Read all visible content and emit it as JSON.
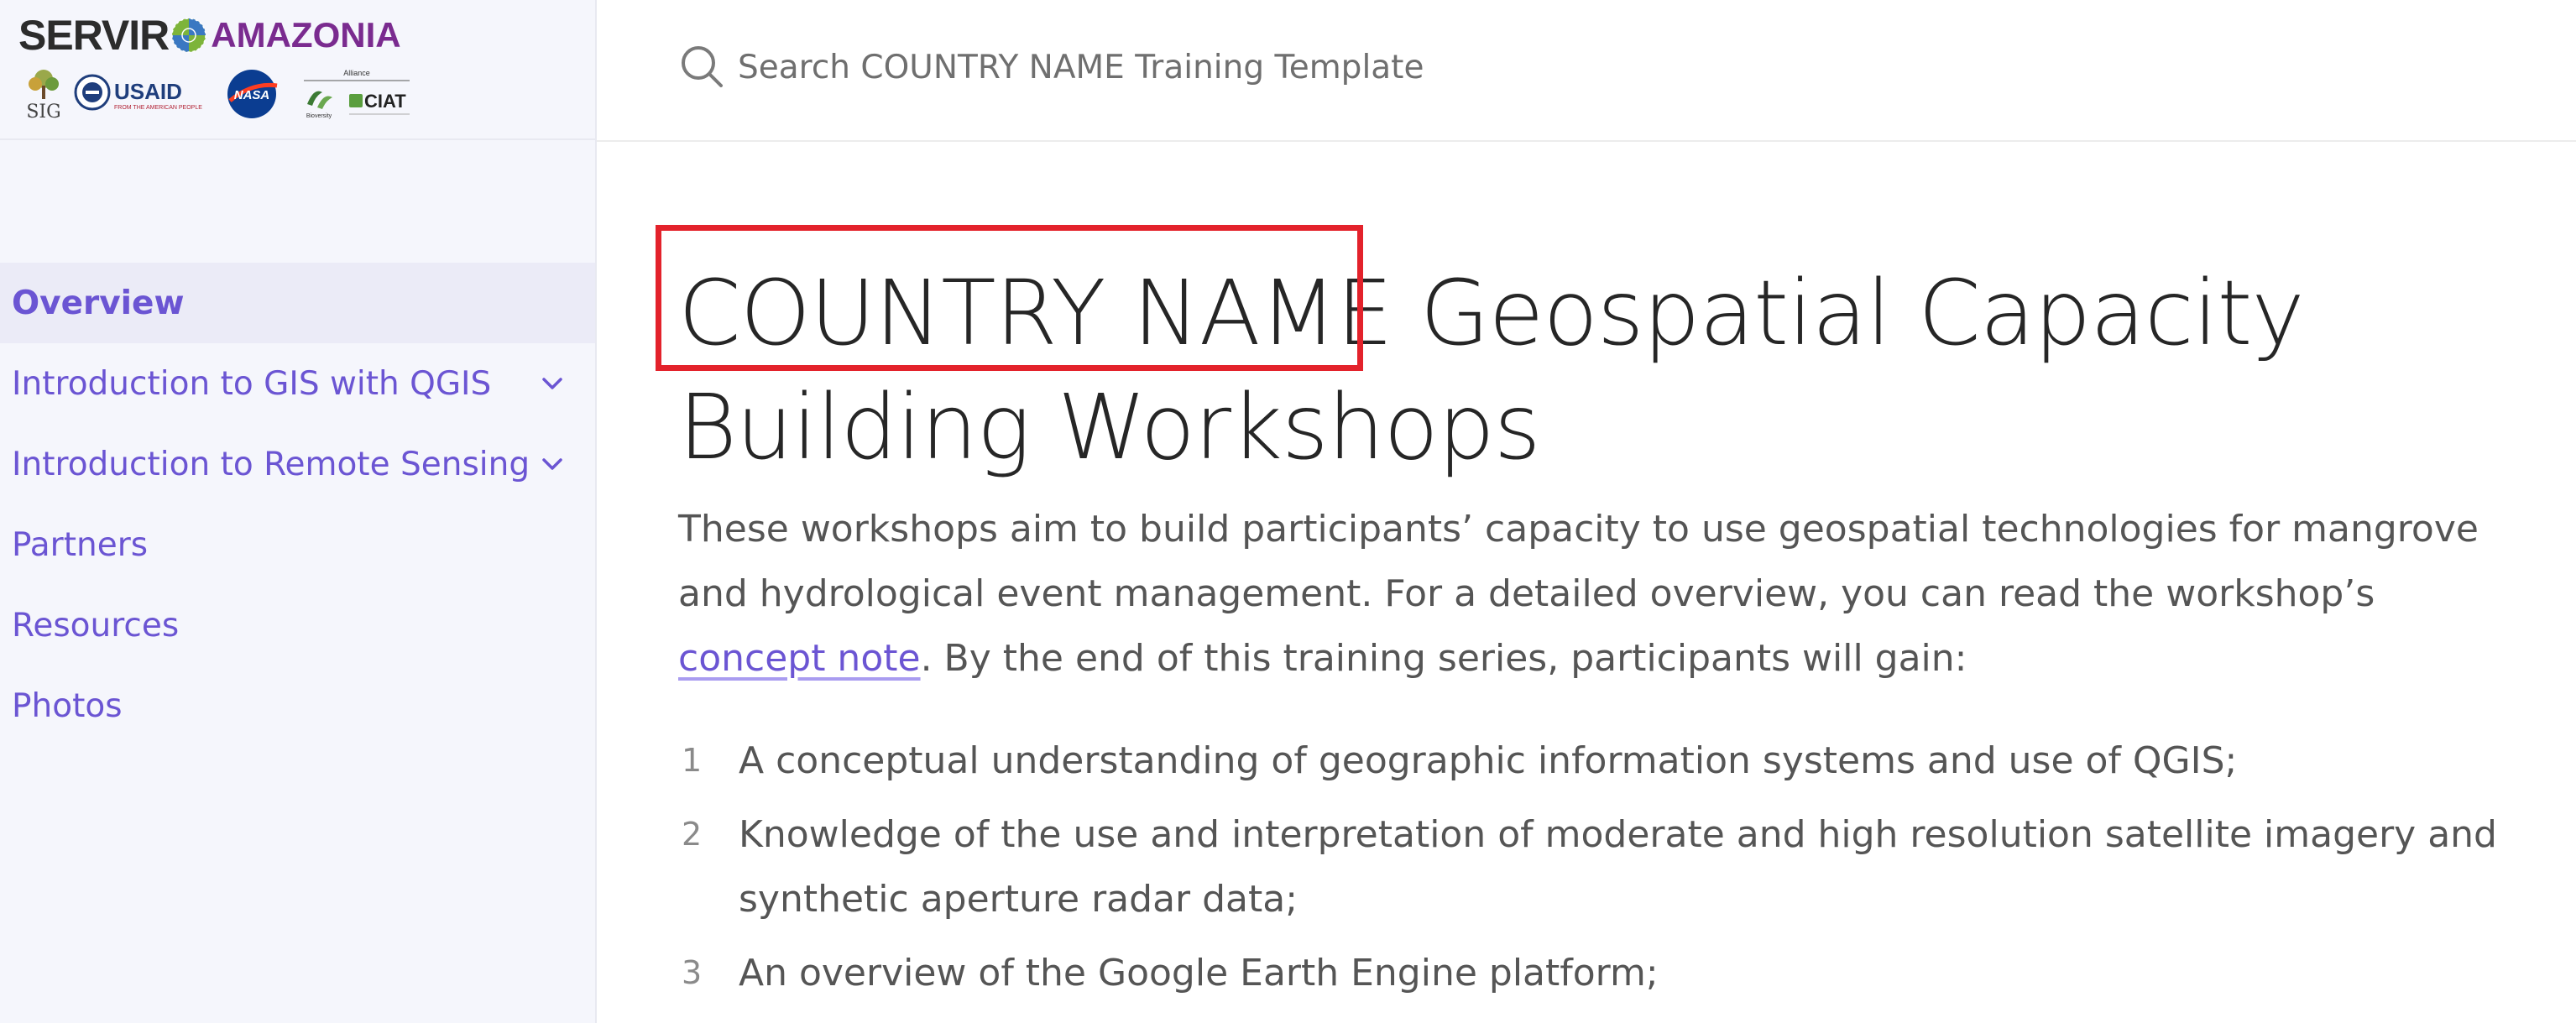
{
  "logo": {
    "brand": "SERVIR",
    "region": "AMAZONIA",
    "partners": [
      {
        "icon": "sig-logo",
        "text": "SIG"
      },
      {
        "icon": "usaid-logo",
        "text": "USAID",
        "subtext": "FROM THE AMERICAN PEOPLE"
      },
      {
        "icon": "nasa-logo",
        "text": "NASA"
      },
      {
        "icon": "alliance-bioversity-ciat-logo",
        "text": "CIAT",
        "header": "Alliance",
        "subtext": "Bioversity"
      }
    ]
  },
  "search": {
    "placeholder": "Search COUNTRY NAME Training Template"
  },
  "sidebar": {
    "items": [
      {
        "label": "Overview",
        "active": true,
        "expandable": false
      },
      {
        "label": "Introduction to GIS with QGIS",
        "active": false,
        "expandable": true
      },
      {
        "label": "Introduction to Remote Sensing",
        "active": false,
        "expandable": true
      },
      {
        "label": "Partners",
        "active": false,
        "expandable": false
      },
      {
        "label": "Resources",
        "active": false,
        "expandable": false
      },
      {
        "label": "Photos",
        "active": false,
        "expandable": false
      }
    ]
  },
  "main": {
    "title": "COUNTRY NAME Geospatial Capacity Building Workshops",
    "intro_before_link": "These workshops aim to build participants’ capacity to use geospatial technologies for mangrove and hydrological event management. For a detailed overview, you can read the workshop’s ",
    "intro_link": "concept note",
    "intro_after_link": ". By the end of this training series, participants will gain:",
    "list": [
      {
        "number": "1",
        "text": "A conceptual understanding of geographic information systems and use of QGIS;"
      },
      {
        "number": "2",
        "text": "Knowledge of the use and interpretation of moderate and high resolution satellite imagery and synthetic aperture radar data;"
      },
      {
        "number": "3",
        "text": "An overview of the Google Earth Engine platform;"
      }
    ]
  },
  "colors": {
    "accent": "#6b55d3",
    "highlight_border": "#e3222b",
    "sidebar_bg": "#f5f6fc",
    "active_item_bg": "#ebebf7",
    "amazonia_purple": "#7a2b8f"
  }
}
